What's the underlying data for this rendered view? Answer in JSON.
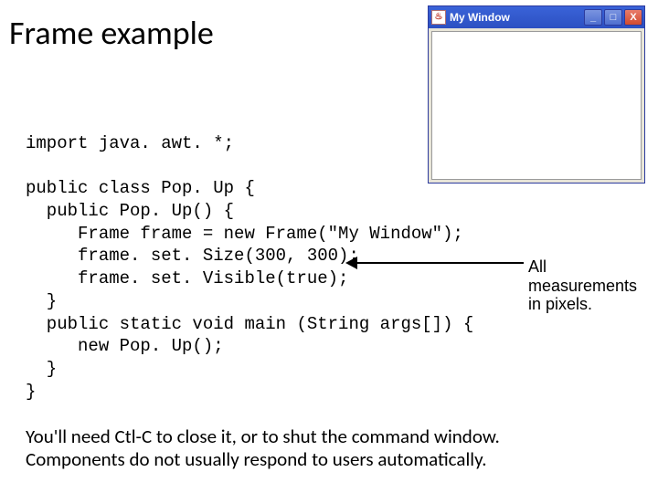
{
  "title": "Frame example",
  "code": "import java. awt. *;\n\npublic class Pop. Up {\n  public Pop. Up() {\n     Frame frame = new Frame(\"My Window\");\n     frame. set. Size(300, 300);\n     frame. set. Visible(true);\n  }\n  public static void main (String args[]) {\n     new Pop. Up();\n  }\n}",
  "annotation": {
    "line1": "All measurements",
    "line2": "in pixels."
  },
  "footer": {
    "line1": "You'll need Ctl-C to close it, or to shut the command window.",
    "line2": "Components do not usually respond to users automatically."
  },
  "window": {
    "title": "My Window",
    "java_icon_glyph": "♨",
    "minimize": "_",
    "maximize": "□",
    "close": "X"
  }
}
